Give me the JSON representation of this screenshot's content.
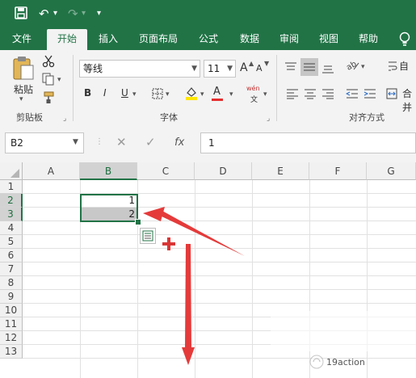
{
  "qat": {
    "save_icon": "save-icon",
    "undo_glyph": "↶",
    "undo_dd": "▾",
    "redo_glyph": "↷",
    "redo_dd": "▾",
    "customize_glyph": "▾"
  },
  "ribbon_tabs": [
    "文件",
    "开始",
    "插入",
    "页面布局",
    "公式",
    "数据",
    "审阅",
    "视图",
    "帮助"
  ],
  "active_tab": "开始",
  "clipboard": {
    "paste_label": "粘贴",
    "group_label": "剪贴板"
  },
  "font": {
    "name": "等线",
    "size": "11",
    "bold": "B",
    "italic": "I",
    "underline": "U",
    "grow": "A",
    "shrink": "A",
    "font_color_letter": "A",
    "phonetic": "wén",
    "group_label": "字体"
  },
  "alignment": {
    "group_label": "对齐方式",
    "wrap_label": "自",
    "merge_label": "合并"
  },
  "formula_bar": {
    "name_box": "B2",
    "fx_label": "fx",
    "value": "1"
  },
  "columns": [
    "A",
    "B",
    "C",
    "D",
    "E",
    "F",
    "G"
  ],
  "rows": [
    "1",
    "2",
    "3",
    "4",
    "5",
    "6",
    "7",
    "8",
    "9",
    "10",
    "11",
    "12",
    "13"
  ],
  "cells": {
    "B2": "1",
    "B3": "2"
  },
  "selection": "B2:B3",
  "watermark": "19action",
  "colors": {
    "accent": "#217346",
    "arrow": "#e53a3a",
    "ribbon_bg": "#f3f3f3"
  }
}
